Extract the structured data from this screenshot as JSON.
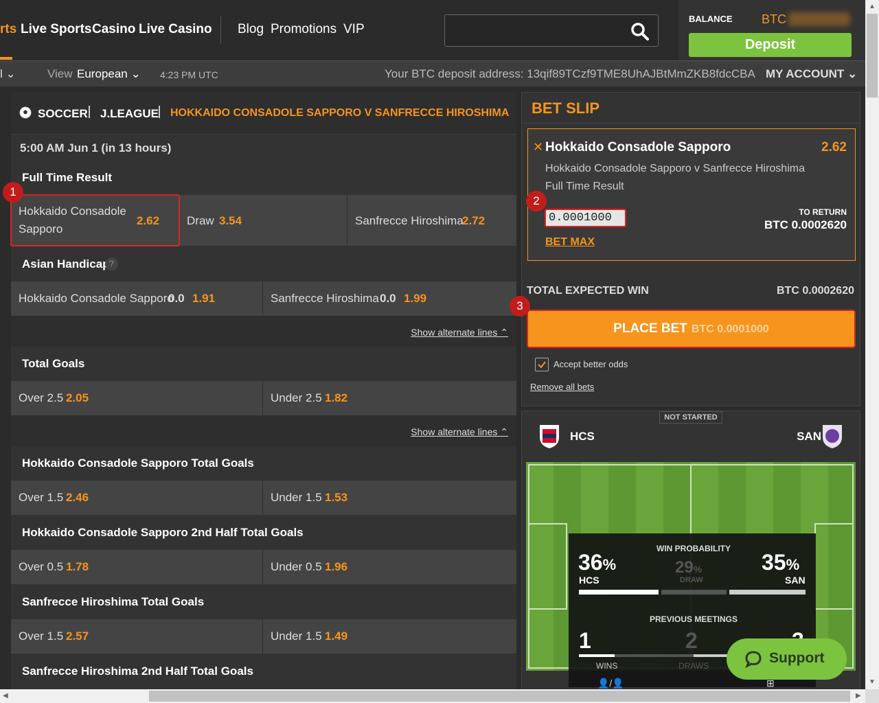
{
  "nav": {
    "sports_fragment": "rts",
    "live_sports": "Live Sports",
    "casino": "Casino",
    "live_casino": "Live Casino",
    "blog": "Blog",
    "promotions": "Promotions",
    "vip": "VIP"
  },
  "balance": {
    "label": "BALANCE",
    "currency": "BTC",
    "deposit_label": "Deposit"
  },
  "subbar": {
    "view_label": "View",
    "view_value": "European",
    "time": "4:23 PM UTC",
    "deposit_address": "Your BTC deposit address: 13qif89TCzf9TME8UhAJBtMmZKB8fdcCBA",
    "my_account": "MY ACCOUNT"
  },
  "breadcrumb": {
    "sport": "SOCCER",
    "league": "J.LEAGUE",
    "match": "HOKKAIDO CONSADOLE SAPPORO V SANFRECCE HIROSHIMA"
  },
  "match_time": "5:00 AM Jun 1  (in 13 hours)",
  "markets": {
    "full_time": {
      "title": "Full Time Result",
      "home_label_1": "Hokkaido Consadole",
      "home_label_2": "Sapporo",
      "home_odds": "2.62",
      "draw_label": "Draw",
      "draw_odds": "3.54",
      "away_label": "Sanfrecce Hiroshima",
      "away_odds": "2.72"
    },
    "asian_handicap": {
      "title": "Asian Handicap",
      "help": "?",
      "home_label": "Hokkaido Consadole Sapporo",
      "home_line": "0.0",
      "home_odds": "1.91",
      "away_label": "Sanfrecce Hiroshima",
      "away_line": "0.0",
      "away_odds": "1.99",
      "alt_link": "Show alternate lines"
    },
    "total_goals": {
      "title": "Total Goals",
      "over_label": "Over 2.5",
      "over_odds": "2.05",
      "under_label": "Under 2.5",
      "under_odds": "1.82",
      "alt_link": "Show alternate lines"
    },
    "home_total": {
      "title": "Hokkaido Consadole Sapporo Total Goals",
      "over_label": "Over 1.5",
      "over_odds": "2.46",
      "under_label": "Under 1.5",
      "under_odds": "1.53"
    },
    "home_2h_total": {
      "title": "Hokkaido Consadole Sapporo 2nd Half Total Goals",
      "over_label": "Over 0.5",
      "over_odds": "1.78",
      "under_label": "Under 0.5",
      "under_odds": "1.96"
    },
    "away_total": {
      "title": "Sanfrecce Hiroshima Total Goals",
      "over_label": "Over 1.5",
      "over_odds": "2.57",
      "under_label": "Under 1.5",
      "under_odds": "1.49"
    },
    "away_2h_total": {
      "title": "Sanfrecce Hiroshima 2nd Half Total Goals"
    }
  },
  "betslip": {
    "title": "BET SLIP",
    "selection": "Hokkaido Consadole Sapporo",
    "odds": "2.62",
    "match": "Hokkaido Consadole Sapporo v Sanfrecce Hiroshima",
    "market": "Full Time Result",
    "stake": "0.0001000",
    "to_return_label": "TO RETURN",
    "to_return_value": "BTC 0.0002620",
    "bet_max": "BET MAX",
    "total_expected_win_label": "TOTAL EXPECTED WIN",
    "total_expected_win_value": "BTC 0.0002620",
    "place_bet_label": "PLACE BET",
    "place_bet_amount": "BTC 0.0001000",
    "accept_better_odds": "Accept better odds",
    "accept_better_odds_checked": true,
    "remove_all": "Remove all bets"
  },
  "markers": {
    "m1": "1",
    "m2": "2",
    "m3": "3"
  },
  "scoreboard": {
    "status": "NOT STARTED",
    "team_a": "HCS",
    "team_b": "SAN",
    "win_probability_label": "WIN PROBABILITY",
    "home_pct": "36",
    "draw_pct": "29",
    "away_pct": "35",
    "pct_sign": "%",
    "draw_label": "DRAW",
    "previous_meetings_label": "PREVIOUS MEETINGS",
    "home_wins": "1",
    "draws": "2",
    "away_wins": "3",
    "wins_label": "WINS",
    "draws_label": "DRAWS"
  },
  "support": {
    "label": "Support"
  },
  "colors": {
    "accent": "#f7941d",
    "green": "#7cc43f",
    "marker": "#c21d1d"
  }
}
